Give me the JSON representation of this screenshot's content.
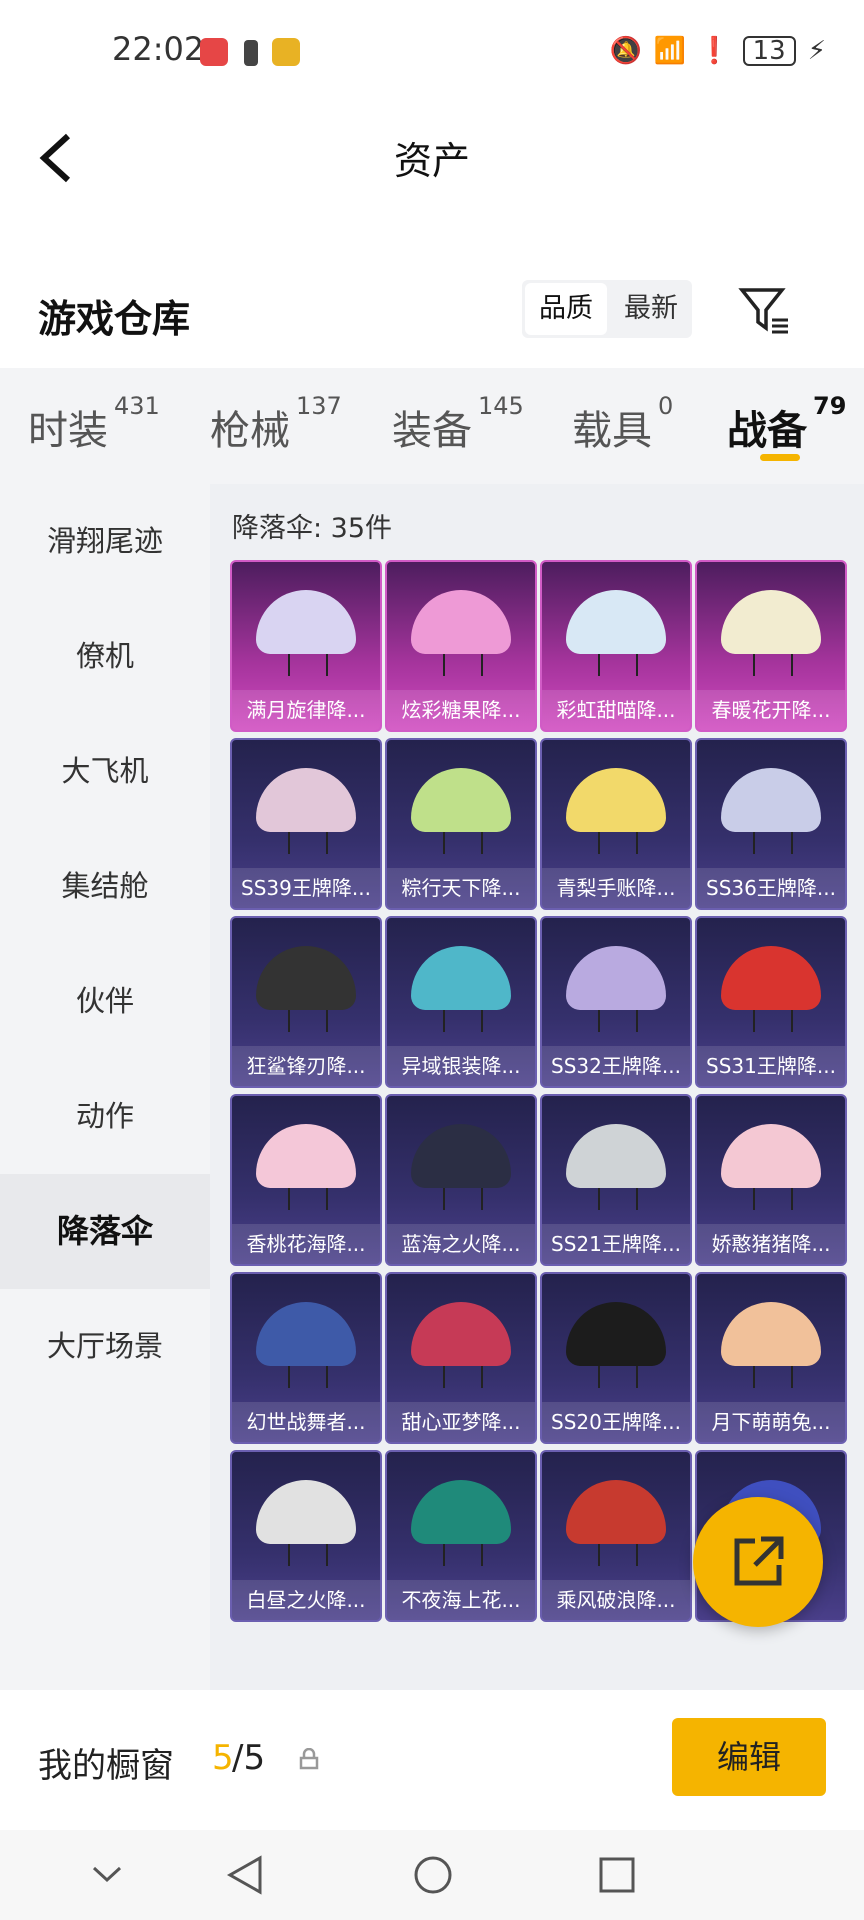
{
  "status_bar": {
    "time": "22:02",
    "battery": "13",
    "icons": [
      "app-red-icon",
      "battery-saver-icon",
      "app-yellow-icon",
      "mute-icon",
      "wifi-icon",
      "alert-icon",
      "charging-icon"
    ]
  },
  "header": {
    "title": "资产",
    "back_icon": "chevron-left-icon"
  },
  "section": {
    "title": "游戏仓库",
    "sort": [
      "品质",
      "最新"
    ],
    "sort_active": "品质",
    "filter_icon": "filter-icon"
  },
  "tabs": [
    {
      "label": "时装",
      "count": "431"
    },
    {
      "label": "枪械",
      "count": "137"
    },
    {
      "label": "装备",
      "count": "145"
    },
    {
      "label": "载具",
      "count": "0"
    },
    {
      "label": "战备",
      "count": "79"
    }
  ],
  "active_tab": "战备",
  "side_nav": [
    "滑翔尾迹",
    "僚机",
    "大飞机",
    "集结舱",
    "伙伴",
    "动作",
    "降落伞",
    "大厅场景"
  ],
  "active_side": "降落伞",
  "grid": {
    "count_label": "降落伞: 35件",
    "items": [
      {
        "name": "满月旋律降...",
        "tier": "gold",
        "color": "#d9d4f2"
      },
      {
        "name": "炫彩糖果降...",
        "tier": "gold",
        "color": "#ee9ad6"
      },
      {
        "name": "彩虹甜喵降...",
        "tier": "gold",
        "color": "#d8e8f5"
      },
      {
        "name": "春暖花开降...",
        "tier": "gold",
        "color": "#f2ecd0"
      },
      {
        "name": "SS39王牌降...",
        "tier": "purple",
        "color": "#e2c7d9"
      },
      {
        "name": "粽行天下降...",
        "tier": "purple",
        "color": "#bfe08a"
      },
      {
        "name": "青梨手账降...",
        "tier": "purple",
        "color": "#f2d96a"
      },
      {
        "name": "SS36王牌降...",
        "tier": "purple",
        "color": "#c9cde8"
      },
      {
        "name": "狂鲨锋刃降...",
        "tier": "purple",
        "color": "#333333"
      },
      {
        "name": "异域银装降...",
        "tier": "purple",
        "color": "#4fb7c9"
      },
      {
        "name": "SS32王牌降...",
        "tier": "purple",
        "color": "#b9aae0"
      },
      {
        "name": "SS31王牌降...",
        "tier": "purple",
        "color": "#d9342f"
      },
      {
        "name": "香桃花海降...",
        "tier": "purple",
        "color": "#f4c7d8"
      },
      {
        "name": "蓝海之火降...",
        "tier": "purple",
        "color": "#2b2e44"
      },
      {
        "name": "SS21王牌降...",
        "tier": "purple",
        "color": "#cfd3d6"
      },
      {
        "name": "娇憨猪猪降...",
        "tier": "purple",
        "color": "#f4c8d3"
      },
      {
        "name": "幻世战舞者...",
        "tier": "purple",
        "color": "#3e5aa8"
      },
      {
        "name": "甜心亚梦降...",
        "tier": "purple",
        "color": "#c63a56"
      },
      {
        "name": "SS20王牌降...",
        "tier": "purple",
        "color": "#1c1c1c"
      },
      {
        "name": "月下萌萌兔...",
        "tier": "purple",
        "color": "#f1c19a"
      },
      {
        "name": "白昼之火降...",
        "tier": "purple",
        "color": "#e1e1e1"
      },
      {
        "name": "不夜海上花...",
        "tier": "purple",
        "color": "#1f8a7a"
      },
      {
        "name": "乘风破浪降...",
        "tier": "purple",
        "color": "#c73a2f"
      },
      {
        "name": "",
        "tier": "purple",
        "color": "#3f4fbf"
      }
    ]
  },
  "fab_icon": "share-external-icon",
  "showcase": {
    "label": "我的橱窗",
    "current": "5",
    "total": "/5",
    "lock_icon": "lock-icon",
    "edit_label": "编辑"
  },
  "sysnav": [
    "chevron-down-icon",
    "back-triangle-icon",
    "home-circle-icon",
    "recent-square-icon"
  ]
}
